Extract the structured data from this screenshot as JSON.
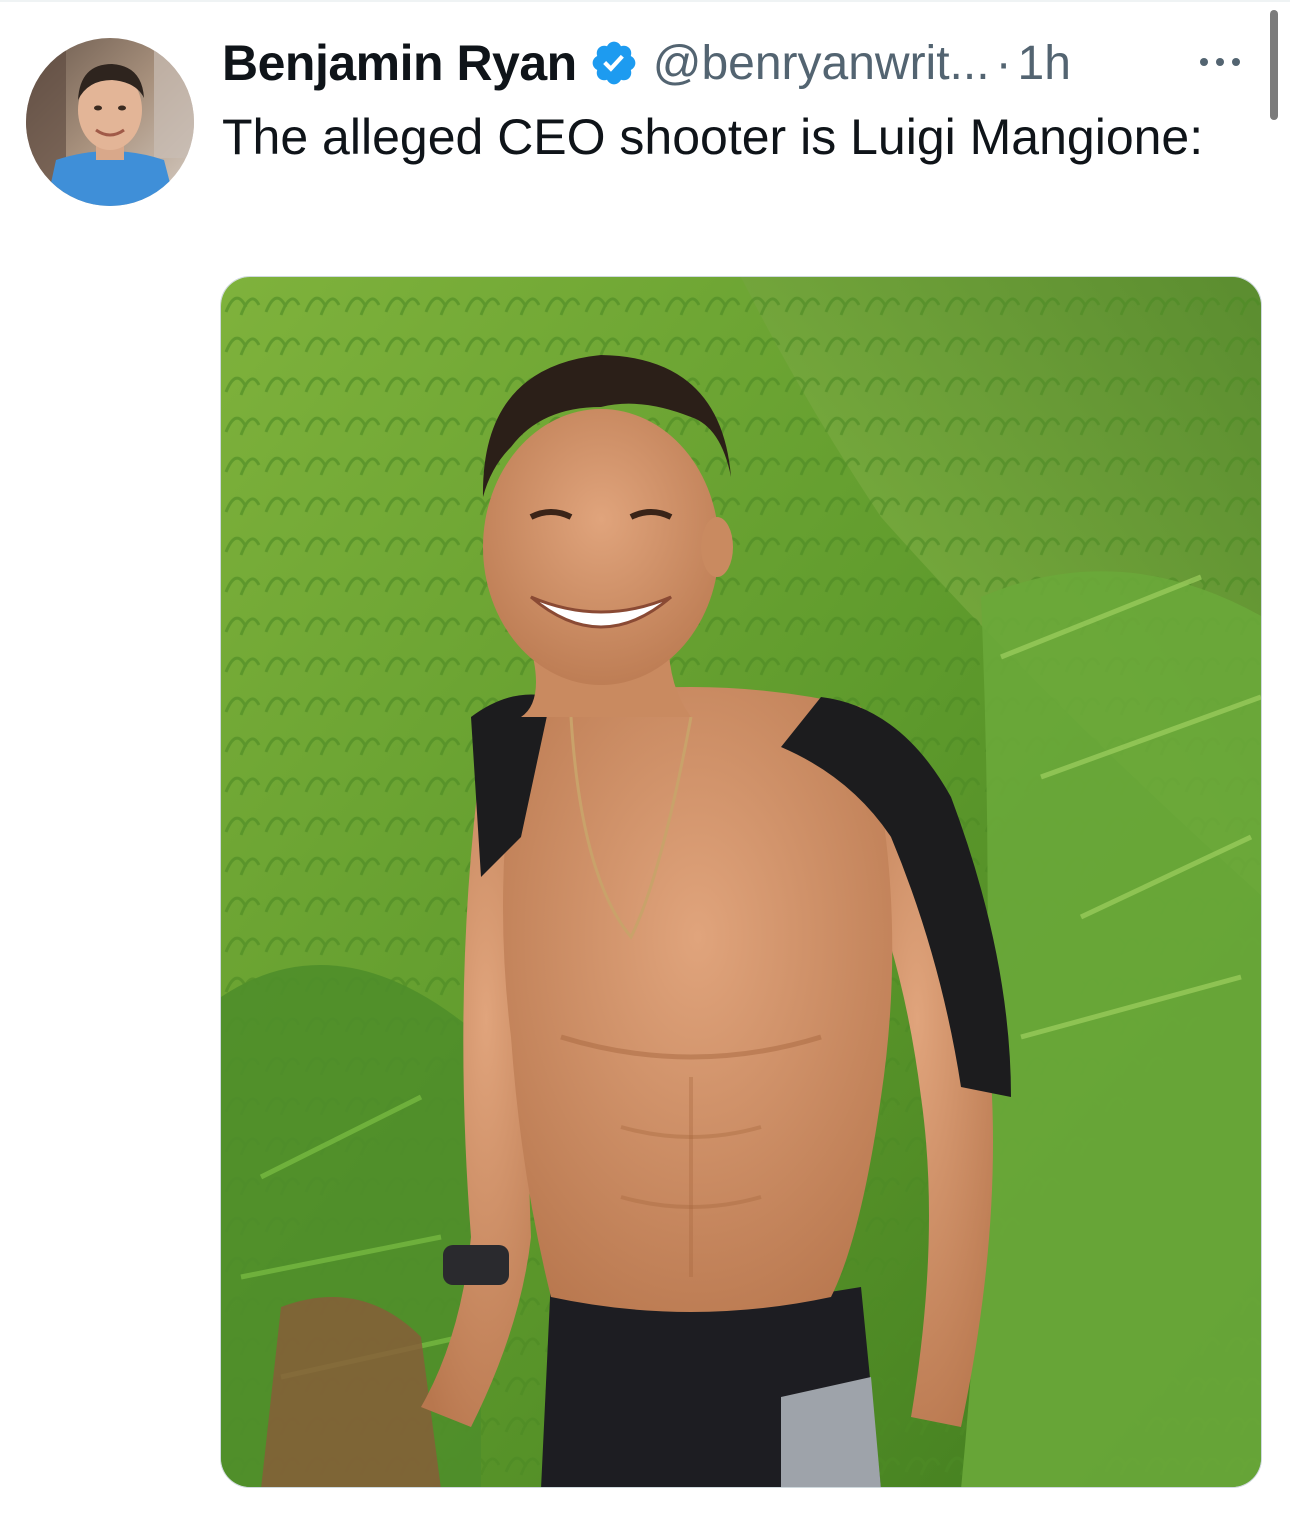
{
  "tweet": {
    "author": {
      "display_name": "Benjamin Ryan",
      "handle": "@benryanwrit...",
      "verified": true,
      "avatar_icon": "avatar-photo"
    },
    "separator": "·",
    "time": "1h",
    "text": "The alleged CEO shooter is Luigi Mangione:",
    "more_icon": "more-horizontal-icon",
    "media": {
      "kind": "photo",
      "content": "man-hiking-on-green-ridge"
    }
  },
  "colors": {
    "text_primary": "#0f1419",
    "text_secondary": "#536471",
    "verified_blue": "#1d9bf0",
    "border": "#cfd9de"
  }
}
